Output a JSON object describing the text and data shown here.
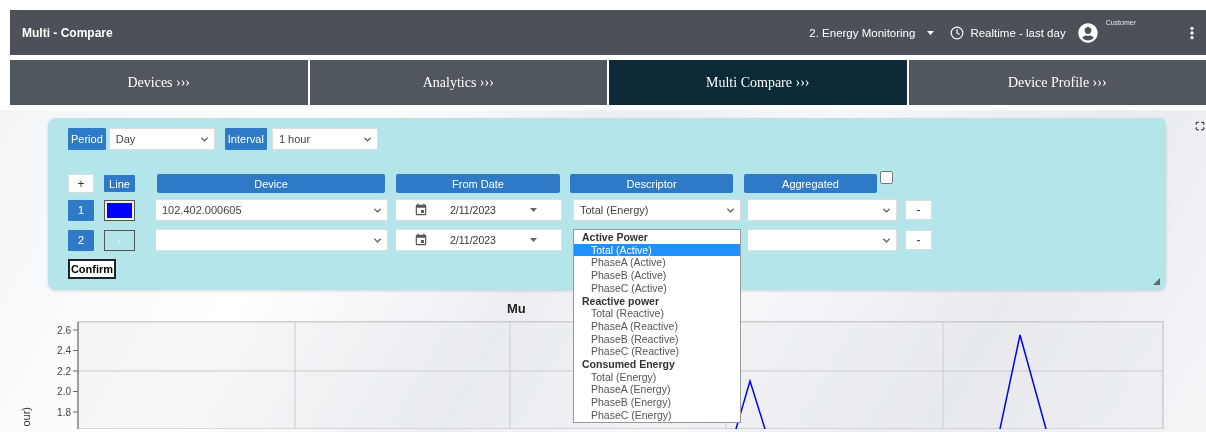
{
  "header": {
    "title": "Multi - Compare",
    "dashboard": "2. Energy Monitoring",
    "time_range": "Realtime - last day",
    "user": "Customer"
  },
  "tabs": [
    {
      "label": "Devices ›››",
      "selected": false
    },
    {
      "label": "Analytics ›››",
      "selected": false
    },
    {
      "label": "Multi Compare ›››",
      "selected": true
    },
    {
      "label": "Device Profile ›››",
      "selected": false
    }
  ],
  "filters": {
    "period_label": "Period",
    "period": "Day",
    "interval_label": "Interval",
    "interval": "1 hour"
  },
  "table": {
    "add_button": "+",
    "line_header": "Line",
    "columns": [
      "Device",
      "From Date",
      "Descriptor",
      "Aggregated"
    ],
    "aggregated_checked": false,
    "rows": [
      {
        "number": "1",
        "color": "#0000ff",
        "device": "102.402.000605",
        "from_date": "2/11/2023",
        "descriptor": "Total (Energy)",
        "remove": "-"
      },
      {
        "number": "2",
        "swatch_text": "-",
        "from_date": "2/11/2023",
        "remove": "-"
      }
    ]
  },
  "confirm": "Confirm",
  "descriptor_menu": {
    "groups": [
      {
        "label": "Active Power",
        "options": [
          {
            "label": "Total (Active)",
            "selected": true
          },
          {
            "label": "PhaseA (Active)",
            "selected": false
          },
          {
            "label": "PhaseB (Active)",
            "selected": false
          },
          {
            "label": "PhaseC (Active)",
            "selected": false
          }
        ]
      },
      {
        "label": "Reactive power",
        "options": [
          {
            "label": "Total (Reactive)",
            "selected": false
          },
          {
            "label": "PhaseA (Reactive)",
            "selected": false
          },
          {
            "label": "PhaseB (Reactive)",
            "selected": false
          },
          {
            "label": "PhaseC (Reactive)",
            "selected": false
          }
        ]
      },
      {
        "label": "Consumed Energy",
        "options": [
          {
            "label": "Total (Energy)",
            "selected": false
          },
          {
            "label": "PhaseA (Energy)",
            "selected": false
          },
          {
            "label": "PhaseB (Energy)",
            "selected": false
          },
          {
            "label": "PhaseC (Energy)",
            "selected": false
          }
        ]
      }
    ]
  },
  "chart": {
    "title": "Mu",
    "ylabel": "our)",
    "yticks": [
      "2.6",
      "2.4",
      "2.2",
      "2.0",
      "1.8"
    ]
  }
}
